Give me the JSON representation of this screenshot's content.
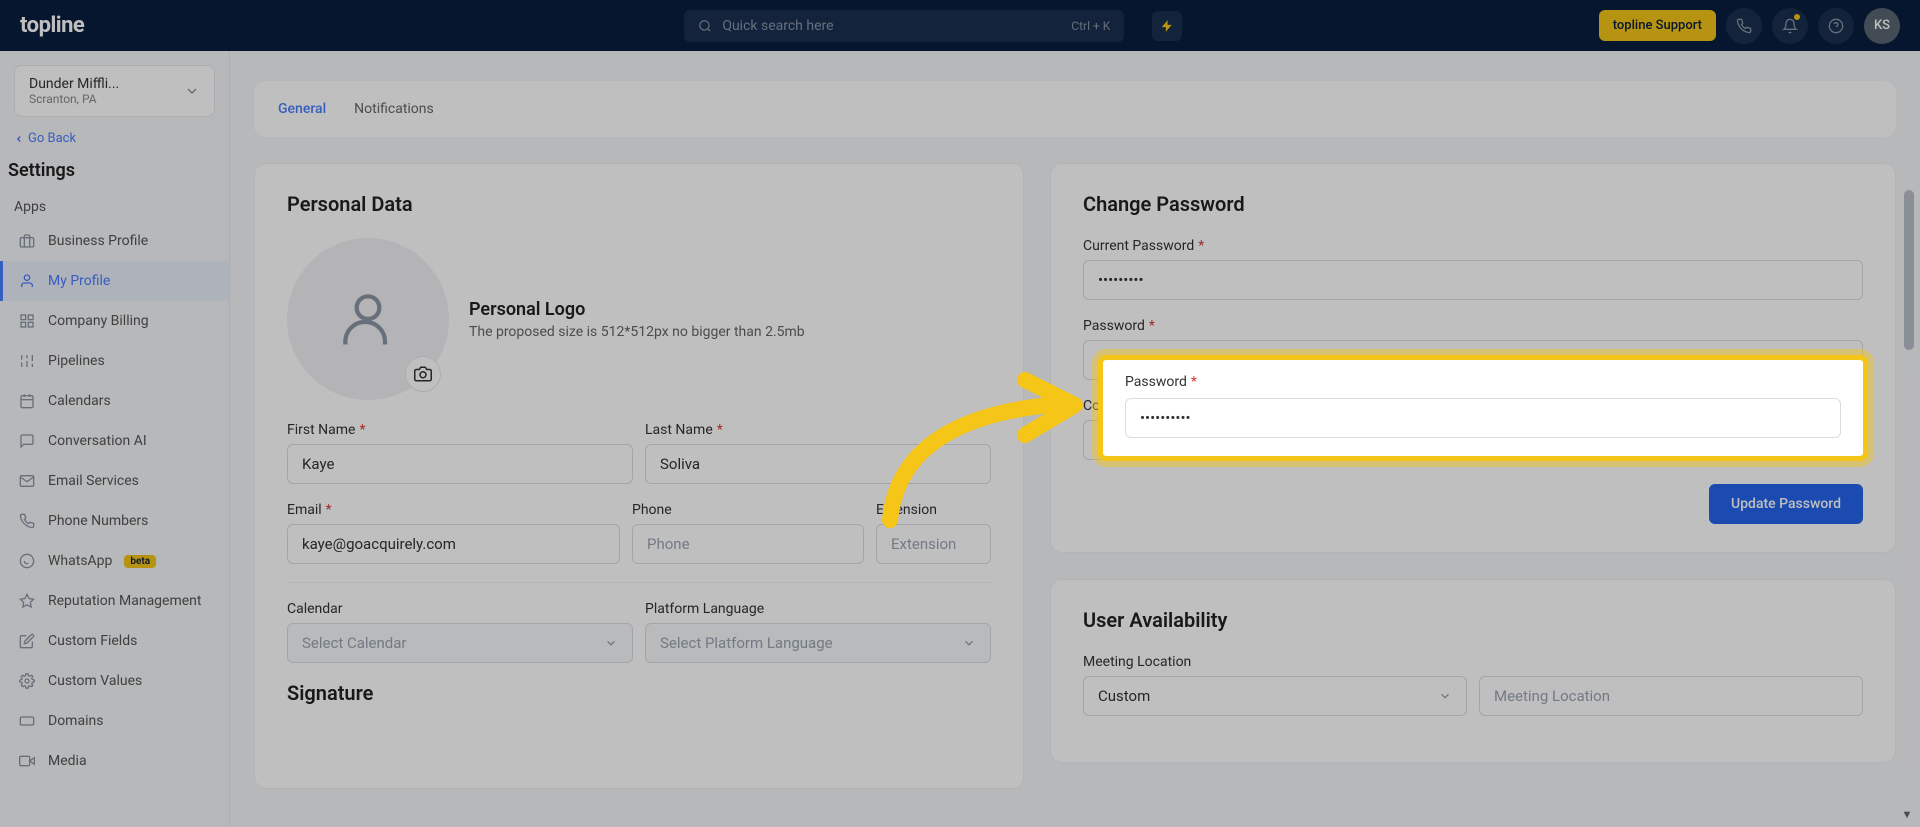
{
  "header": {
    "logo": "topline",
    "search_placeholder": "Quick search here",
    "kbd": "Ctrl + K",
    "support_label": "topline Support",
    "avatar_initials": "KS"
  },
  "sidebar": {
    "org_name": "Dunder Miffli...",
    "org_loc": "Scranton, PA",
    "go_back": "Go Back",
    "title": "Settings",
    "section_apps": "Apps",
    "items": [
      {
        "label": "Business Profile"
      },
      {
        "label": "My Profile"
      },
      {
        "label": "Company Billing"
      },
      {
        "label": "Pipelines"
      },
      {
        "label": "Calendars"
      },
      {
        "label": "Conversation AI"
      },
      {
        "label": "Email Services"
      },
      {
        "label": "Phone Numbers"
      },
      {
        "label": "WhatsApp"
      },
      {
        "label": "Reputation Management"
      },
      {
        "label": "Custom Fields"
      },
      {
        "label": "Custom Values"
      },
      {
        "label": "Domains"
      },
      {
        "label": "Media"
      }
    ],
    "whatsapp_badge": "beta"
  },
  "tabs": {
    "general": "General",
    "notifications": "Notifications"
  },
  "personal": {
    "title": "Personal Data",
    "logo_title": "Personal Logo",
    "logo_hint": "The proposed size is 512*512px no bigger than 2.5mb",
    "first_name_label": "First Name",
    "last_name_label": "Last Name",
    "first_name": "Kaye",
    "last_name": "Soliva",
    "email_label": "Email",
    "email": "kaye@goacquirely.com",
    "phone_label": "Phone",
    "phone_placeholder": "Phone",
    "ext_label": "Extension",
    "ext_placeholder": "Extension",
    "calendar_label": "Calendar",
    "calendar_select": "Select Calendar",
    "lang_label": "Platform Language",
    "lang_select": "Select Platform Language",
    "signature_title": "Signature"
  },
  "password": {
    "title": "Change Password",
    "current_label": "Current Password",
    "current_value": "•••••••••",
    "new_label": "Password",
    "new_value": "••••••••••",
    "confirm_label": "Confirm Password",
    "confirm_value": "••••••••••",
    "button": "Update Password"
  },
  "availability": {
    "title": "User Availability",
    "meeting_loc_label": "Meeting Location",
    "meeting_loc_select": "Custom",
    "meeting_loc_placeholder": "Meeting Location"
  }
}
